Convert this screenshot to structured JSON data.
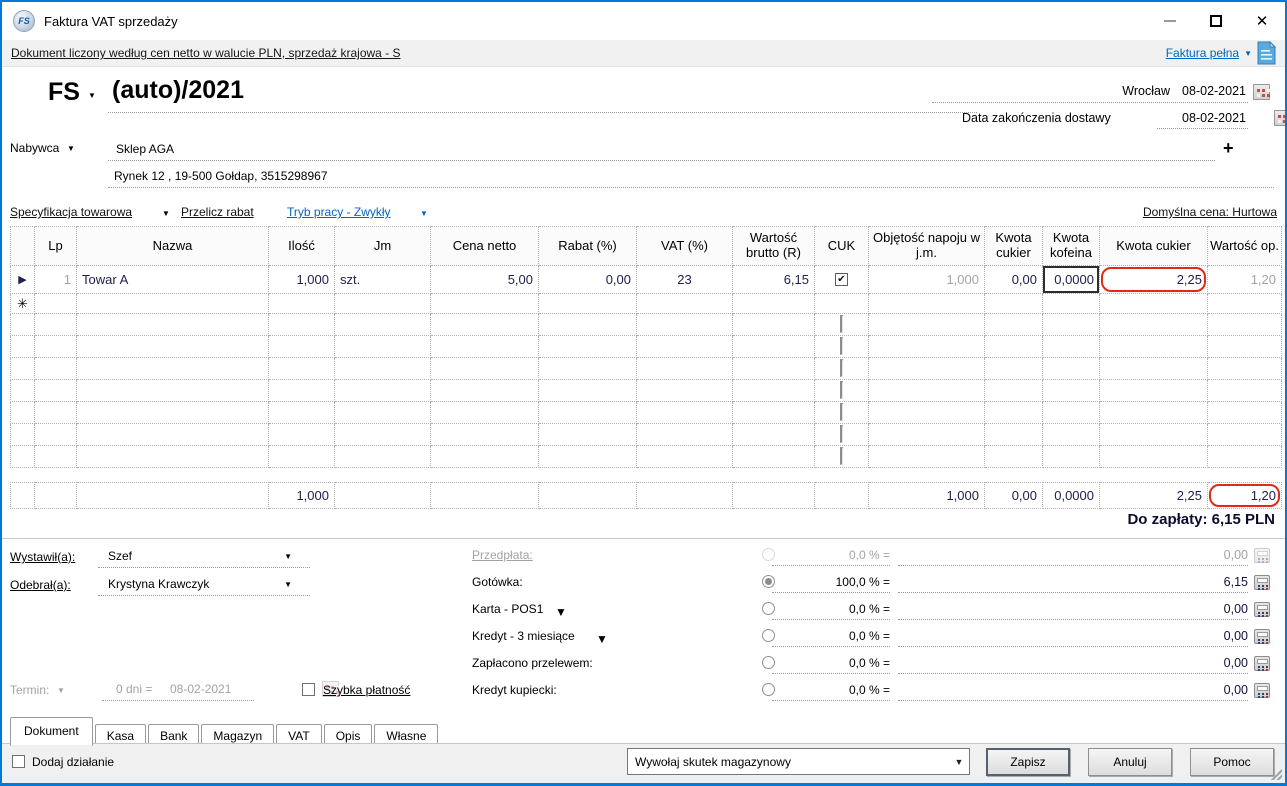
{
  "window": {
    "title": "Faktura VAT sprzedaży"
  },
  "icons": {
    "dropdown": "▼",
    "close": "✕",
    "row_marker": "▶",
    "new_row": "✳",
    "plus": "+",
    "check": "✔"
  },
  "info_bar": {
    "document_rule": "Dokument liczony według cen netto w walucie PLN, sprzedaż krajowa - S",
    "invoice_type": "Faktura pełna"
  },
  "header": {
    "symbol": "FS",
    "number": "(auto)/2021",
    "city": "Wrocław",
    "issue_date": "08-02-2021",
    "delivery_date_label": "Data zakończenia dostawy",
    "delivery_date": "08-02-2021"
  },
  "buyer": {
    "label": "Nabywca",
    "name": "Sklep AGA",
    "address": "Rynek 12 , 19-500 Gołdap, 3515298967"
  },
  "toolbar": {
    "specification": "Specyfikacja towarowa",
    "recalculate_discount": "Przelicz rabat",
    "work_mode": "Tryb pracy - Zwykły",
    "default_price": "Domyślna cena: Hurtowa"
  },
  "table": {
    "columns": [
      "Lp",
      "Nazwa",
      "Ilość",
      "Jm",
      "Cena netto",
      "Rabat (%)",
      "VAT (%)",
      "Wartość brutto (R)",
      "CUK",
      "Objętość napoju w j.m.",
      "Kwota cukier",
      "Kwota kofeina",
      "Kwota cukier",
      "Wartość op."
    ],
    "rows": [
      {
        "lp": "1",
        "name": "Towar A",
        "quantity": "1,000",
        "unit": "szt.",
        "net_price": "5,00",
        "discount": "0,00",
        "vat": "23",
        "gross_value": "6,15",
        "cuk_checked": true,
        "volume": "1,000",
        "sugar_amount": "0,00",
        "caffeine_amount": "0,0000",
        "sugar_amount2": "2,25",
        "packaging_value": "1,20"
      }
    ],
    "summary": {
      "quantity": "1,000",
      "volume": "1,000",
      "sugar_amount": "0,00",
      "caffeine_amount": "0,0000",
      "sugar_amount2": "2,25",
      "packaging_value": "1,20"
    },
    "total_label": "Do zapłaty:",
    "total_value": "6,15 PLN"
  },
  "issued_by": {
    "label": "Wystawił(a):",
    "value": "Szef"
  },
  "received_by": {
    "label": "Odebrał(a):",
    "value": "Krystyna Krawczyk"
  },
  "term": {
    "label": "Termin:",
    "days": "0 dni =",
    "date": "08-02-2021",
    "quick_payment_label": "Szybka płatność"
  },
  "payments": {
    "rows": [
      {
        "label": "Przedpłata:",
        "percent": "0,0 % =",
        "amount": "0,00",
        "selected": false,
        "disabled": true
      },
      {
        "label": "Gotówka:",
        "percent": "100,0 % =",
        "amount": "6,15",
        "selected": true
      },
      {
        "label": "Karta - POS1",
        "percent": "0,0 % =",
        "amount": "0,00",
        "dropdown": true
      },
      {
        "label": "Kredyt - 3 miesiące",
        "percent": "0,0 % =",
        "amount": "0,00",
        "dropdown": true
      },
      {
        "label": "Zapłacono przelewem:",
        "percent": "0,0 % =",
        "amount": "0,00"
      },
      {
        "label": "Kredyt kupiecki:",
        "percent": "0,0 % =",
        "amount": "0,00"
      }
    ]
  },
  "tabs": {
    "items": [
      "Dokument",
      "Kasa",
      "Bank",
      "Magazyn",
      "VAT",
      "Opis",
      "Własne"
    ],
    "active": "Dokument"
  },
  "footer": {
    "add_action_label": "Dodaj działanie",
    "warehouse_effect": "Wywołaj skutek magazynowy",
    "save": "Zapisz",
    "cancel": "Anuluj",
    "help": "Pomoc"
  },
  "colors": {
    "window_border": "#0079d8",
    "link_blue": "#0065c8",
    "highlight_red": "#df2a18",
    "disabled_gray": "#a3a3a3",
    "grid_text": "#20204f"
  }
}
